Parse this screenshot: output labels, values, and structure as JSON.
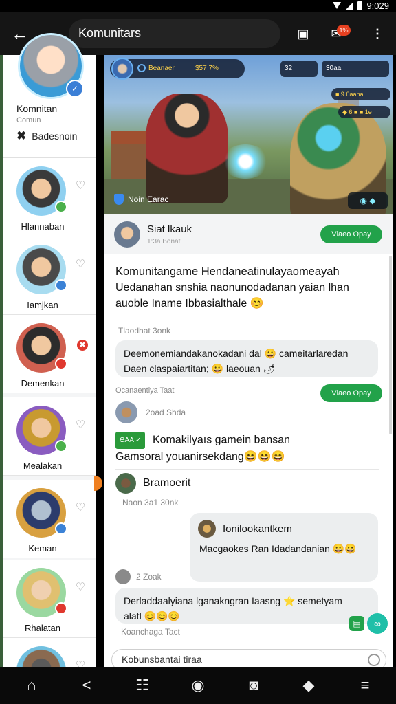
{
  "statusbar": {
    "time": "9:029"
  },
  "appbar": {
    "back_icon": "←",
    "title": "Komunitars",
    "cast_icon": "▣",
    "notif_icon": "✉",
    "notif_badge": "1%",
    "more_icon": "⋮"
  },
  "sidebar": {
    "self": {
      "name": "Komnitan",
      "sub": "Comun",
      "tool_icon": "✖",
      "tool_label": "Badesnoin"
    },
    "friends": [
      {
        "name": "Hlannaban"
      },
      {
        "name": "Iamjkan"
      },
      {
        "name": "Demenkan"
      },
      {
        "name": "Mealakan"
      },
      {
        "name": "Keman"
      },
      {
        "name": "Rhalatan"
      }
    ],
    "heart_icon": "♡",
    "remove_icon": "✖"
  },
  "banner": {
    "hud_left_1": "Beanaer",
    "hud_left_2": "$57 7%",
    "hud_r1": "32",
    "hud_r2": "30aa",
    "mini1": "■ 9 0aana",
    "mini2": "◆ 6 ■ ■ 1e",
    "caption": "Noin Earac",
    "corner_icons": "◉  ◆"
  },
  "post": {
    "author": "Siat lkauk",
    "time": "1:3a Bonat",
    "pill": "Vlaeo Opay",
    "line1": "Komunitangame Hendaneatinulayaomeayah",
    "line2": "Uedanahan snshia naonunodadanan yaian lhan",
    "line3": "auoble Iname Ibbasialthale 😊"
  },
  "comments": {
    "label": "Tlaodhat 3onk",
    "bubble1_line1": "Deemonemiandakanokadani dal 😀 cameitarlaredan",
    "bubble1_line2": "Daen claspaiartitan; 😀 laeouan 🌶",
    "c2_label": "Ocanaentiya Taat",
    "c2_pill": "Vlaeo Opay",
    "c2_time": "2oad Shda",
    "game_tag": "ƏAA ✓",
    "game_line1": "Komakilyaıs gamein bansan",
    "game_line2": "Gamsoral youanirsekdang😆😆😆",
    "user3_name": "Bramoerit",
    "user3_time": "Naon 3a1 30nk",
    "quote_name": "Ionilookantkem",
    "quote_text": "Macgaokes Ran Idadandanian 😀😀",
    "c4_time": "2 Zoak",
    "bubble4_line1": "Derladdaalyiana lganakngran Iaasng ⭐ semetyam",
    "bubble4_line2": "alatl 😊😊😊",
    "c5_label": "Koanchaga Tact",
    "input_placeholder": "Kobunsbantai tiraa"
  },
  "nav": {
    "home_icon": "⌂",
    "back_icon": "<",
    "apps_icon": "☷",
    "record_icon": "◉",
    "camera_icon": "◙",
    "box_icon": "◆",
    "menu_icon": "≡"
  },
  "colors": {
    "accent_green": "#22a24a",
    "badge_red": "#e64020",
    "teal": "#1fbfa8"
  }
}
